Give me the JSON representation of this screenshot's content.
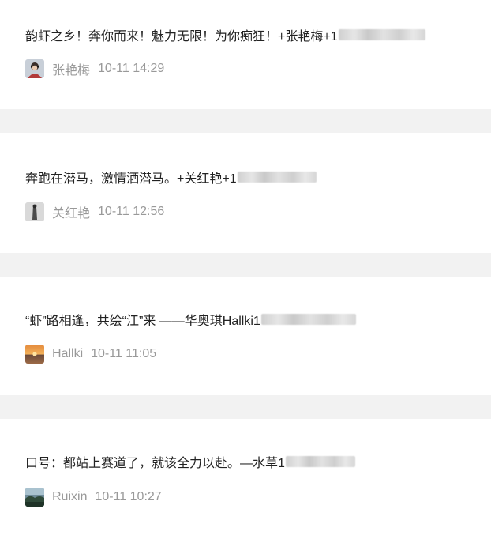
{
  "posts": [
    {
      "title": "韵虾之乡！奔你而来！魅力无限！为你痴狂！+张艳梅+1",
      "author": "张艳梅",
      "time": "10-11 14:29"
    },
    {
      "title": "奔跑在潜马，激情洒潜马。+关红艳+1",
      "author": "关红艳",
      "time": "10-11 12:56"
    },
    {
      "title": "“虾”路相逢，共绘“江”来 ——华奥琪Hallki1",
      "author": "Hallki",
      "time": "10-11 11:05"
    },
    {
      "title": "口号：都站上赛道了，就该全力以赴。—水草1",
      "author": "Ruixin",
      "time": "10-11 10:27"
    }
  ]
}
